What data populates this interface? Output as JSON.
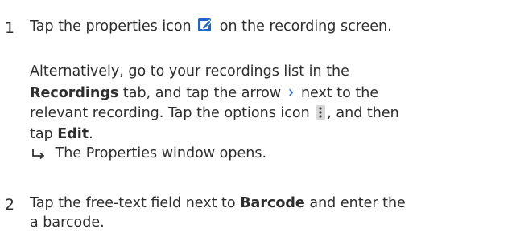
{
  "steps": [
    {
      "number": "1",
      "line1_a": "Tap the properties icon",
      "line1_b": "on the recording screen.",
      "alt_1": "Alternatively, go to your recordings list in the",
      "alt_2_bold": "Recordings",
      "alt_2_rest_a": "tab, and tap the arrow",
      "alt_2_rest_b": "next to the",
      "alt_3_a": "relevant recording. Tap the options icon",
      "alt_3_b": ", and then",
      "alt_4_a": "tap",
      "alt_4_bold": "Edit",
      "alt_4_b": ".",
      "result": "The Properties window opens."
    },
    {
      "number": "2",
      "line1_a": "Tap the free-text field next to",
      "line1_bold": "Barcode",
      "line1_b": "and enter the",
      "line2": "a barcode."
    }
  ],
  "icons": {
    "properties": "edit-properties-icon",
    "arrow": "chevron-right-icon",
    "options": "options-menu-icon",
    "result": "result-arrow-icon"
  },
  "colors": {
    "accent": "#1f64c8",
    "text": "#2e2e2e"
  }
}
